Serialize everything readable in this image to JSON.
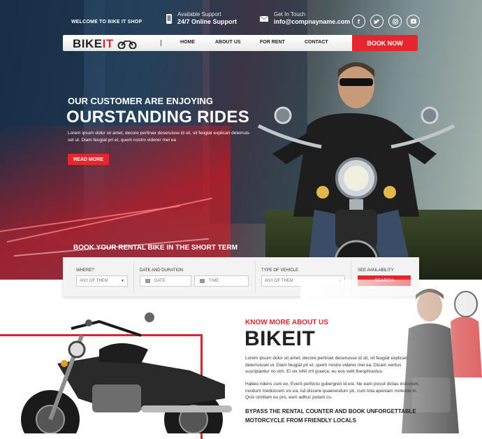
{
  "topbar": {
    "welcome": "WELCOME TO BIKE IT SHOP",
    "support_small": "Available Support",
    "support_big": "24/7 Online Support",
    "touch_small": "Get In Touch",
    "touch_big": "info@compnayname.com",
    "social_icons": [
      "facebook-icon",
      "twitter-icon",
      "instagram-icon",
      "youtube-icon"
    ]
  },
  "nav": {
    "logo_main": "BIKE",
    "logo_accent": "IT",
    "items": [
      "HOME",
      "ABOUT US",
      "FOR RENT",
      "CONTACT"
    ],
    "book_now": "BOOK NOW"
  },
  "hero": {
    "subtitle": "OUR CUSTOMER ARE ENJOYING",
    "title": "OURSTANDING RIDES",
    "description": "Lorem ipsum dolor sit amet, decore pertinax deseruisse id sit, sit feugiat explicari deterruis-set ut. Diam feugiat pri et, quem nostro viderer mel ea",
    "read_more": "READ MORE",
    "rent_title": "BOOK YOUR RENTAL BIKE IN THE SHORT TERM"
  },
  "search": {
    "where_label": "WHERE?",
    "where_value": "ANY OF THEM",
    "date_label": "DATE AND DURATION",
    "date_placeholder": "DATE",
    "time_placeholder": "TIME",
    "type_label": "TYPE OF VEHICLE",
    "type_value": "ANY OF THEM",
    "avail_label": "SEE AVAILABILITY",
    "search_button": "SEARCH"
  },
  "about": {
    "kicker": "KNOW MORE ABOUT US",
    "title": "BIKEIT",
    "para1": "Lorem ipsum dolor sit amet, decore pertinax deseruisse id sit, sit feugiat explicari deterruisset ut. Diam feugiat pri et, quem nostro viderer mel ea. Dicam veritus suscipiantur no vim. Ei vix nihil zril graece, eu eos velit theophrastus.",
    "para2": "Habeo ridens cum ex. Everti perfecto gubergren id est. Ne eam possit dictas indoctum, invidunt mediocrem vis ea. Ad discere quaerendum pri, cum tota apeniam molestie in. Quis omittam eu pro, eam adhuc putant cu.",
    "bypass": "BYPASS THE RENTAL COUNTER AND BOOK UNFORGETTABLE MOTORCYCLE FROM FRIENDLY LOCALS"
  },
  "colors": {
    "accent": "#e5262d",
    "dark": "#222222"
  }
}
